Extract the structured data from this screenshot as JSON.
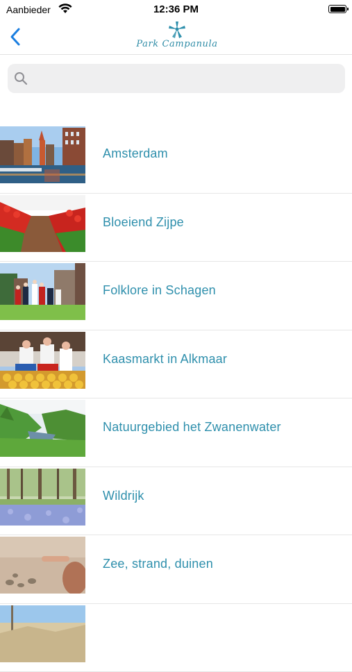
{
  "status_bar": {
    "carrier": "Aanbieder",
    "time": "12:36 PM"
  },
  "nav": {
    "back_icon": "chevron-left-icon",
    "logo_text": "Park Campanula",
    "accent": "#2e8fac"
  },
  "search": {
    "placeholder": "",
    "value": "",
    "icon": "search-icon"
  },
  "items": [
    {
      "label": "Amsterdam",
      "thumb": "canal-city"
    },
    {
      "label": "Bloeiend Zijpe",
      "thumb": "tulip-field"
    },
    {
      "label": "Folklore in Schagen",
      "thumb": "folklore-dancers"
    },
    {
      "label": "Kaasmarkt in Alkmaar",
      "thumb": "cheese-market"
    },
    {
      "label": "Natuurgebied het Zwanenwater",
      "thumb": "nature-reserve"
    },
    {
      "label": "Wildrijk",
      "thumb": "bluebell-forest"
    },
    {
      "label": "Zee, strand, duinen",
      "thumb": "beach-sand"
    },
    {
      "label": "",
      "thumb": "dunes-trail"
    }
  ]
}
